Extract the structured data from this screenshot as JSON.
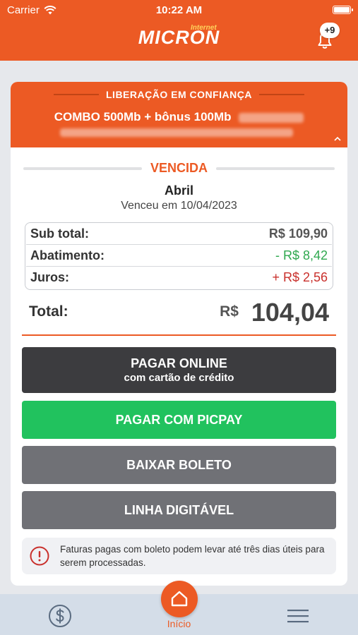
{
  "status_bar": {
    "carrier": "Carrier",
    "time": "10:22 AM"
  },
  "header": {
    "brand": "MICRON",
    "brand_sub": "Internet",
    "notifications_badge": "+9",
    "accent_color": "#ec5a24"
  },
  "plan": {
    "label": "LIBERAÇÃO EM CONFIANÇA",
    "name": "COMBO 500Mb + bônus 100Mb"
  },
  "invoice": {
    "status": "VENCIDA",
    "month": "Abril",
    "due_text": "Venceu em 10/04/2023",
    "breakdown": [
      {
        "label": "Sub total:",
        "value": "R$ 109,90"
      },
      {
        "label": "Abatimento:",
        "value": "- R$ 8,42"
      },
      {
        "label": "Juros:",
        "value": "+ R$ 2,56"
      }
    ],
    "total_label": "Total:",
    "total_currency": "R$",
    "total_amount": "104,04"
  },
  "actions": {
    "pay_online_line1": "PAGAR ONLINE",
    "pay_online_line2": "com cartão de crédito",
    "pay_picpay": "PAGAR COM PICPAY",
    "download_boleto": "BAIXAR BOLETO",
    "digital_line": "LINHA DIGITÁVEL"
  },
  "notice": {
    "text": "Faturas pagas com boleto podem levar até três dias úteis para serem processadas."
  },
  "tabbar": {
    "home_label": "Início"
  }
}
